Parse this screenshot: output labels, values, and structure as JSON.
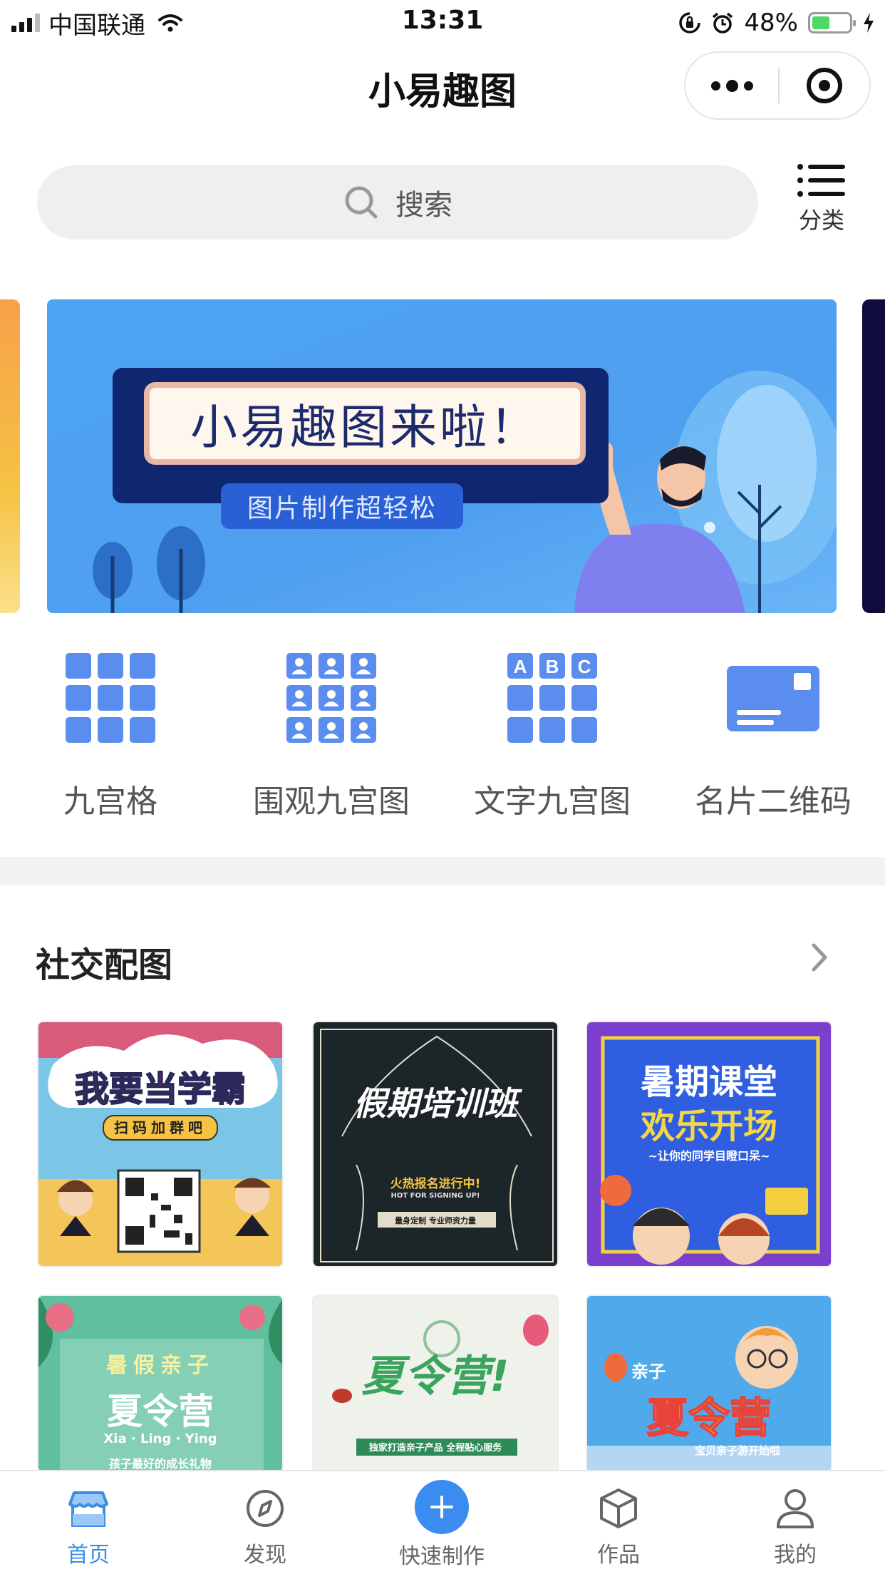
{
  "status_bar": {
    "carrier": "中国联通",
    "time": "13:31",
    "battery": "48%",
    "battery_level": 0.48
  },
  "nav": {
    "title": "小易趣图"
  },
  "search": {
    "placeholder": "搜索",
    "category_label": "分类"
  },
  "banner": {
    "title": "小易趣图来啦！",
    "subtitle": "图片制作超轻松"
  },
  "tools": [
    {
      "label": "九宫格",
      "icon": "grid-icon"
    },
    {
      "label": "围观九宫图",
      "icon": "people-grid-icon"
    },
    {
      "label": "文字九宫图",
      "icon": "text-grid-icon"
    },
    {
      "label": "名片二维码",
      "icon": "card-qrcode-icon"
    }
  ],
  "section": {
    "title": "社交配图"
  },
  "cards": [
    {
      "title": "我要当学霸",
      "subtitle": "扫码加群吧"
    },
    {
      "title": "假期培训班",
      "subtitle": "火热报名进行中!",
      "caption": "HOT FOR SIGNING UP!",
      "tag": "量身定制  专业师资力量"
    },
    {
      "title": "暑期课堂",
      "title2": "欢乐开场",
      "subtitle": "~让你的同学目瞪口呆~"
    },
    {
      "title": "暑假亲子",
      "title2": "夏令营",
      "subtitle": "Xia · Ling · Ying",
      "caption": "孩子最好的成长礼物"
    },
    {
      "title": "夏令营!",
      "subtitle": "独家打造亲子产品 全程贴心服务"
    },
    {
      "title": "亲子",
      "title2": "夏令营",
      "subtitle": "宝贝亲子游开始啦"
    }
  ],
  "tabbar": [
    {
      "label": "首页",
      "icon": "store-icon",
      "active": true
    },
    {
      "label": "发现",
      "icon": "compass-icon",
      "active": false
    },
    {
      "label": "快速制作",
      "icon": "plus-icon",
      "active": false
    },
    {
      "label": "作品",
      "icon": "box-icon",
      "active": false
    },
    {
      "label": "我的",
      "icon": "user-icon",
      "active": false
    }
  ],
  "colors": {
    "accent": "#3a8ee6",
    "icon_blue": "#5b8def",
    "tab_inactive": "#666666"
  }
}
